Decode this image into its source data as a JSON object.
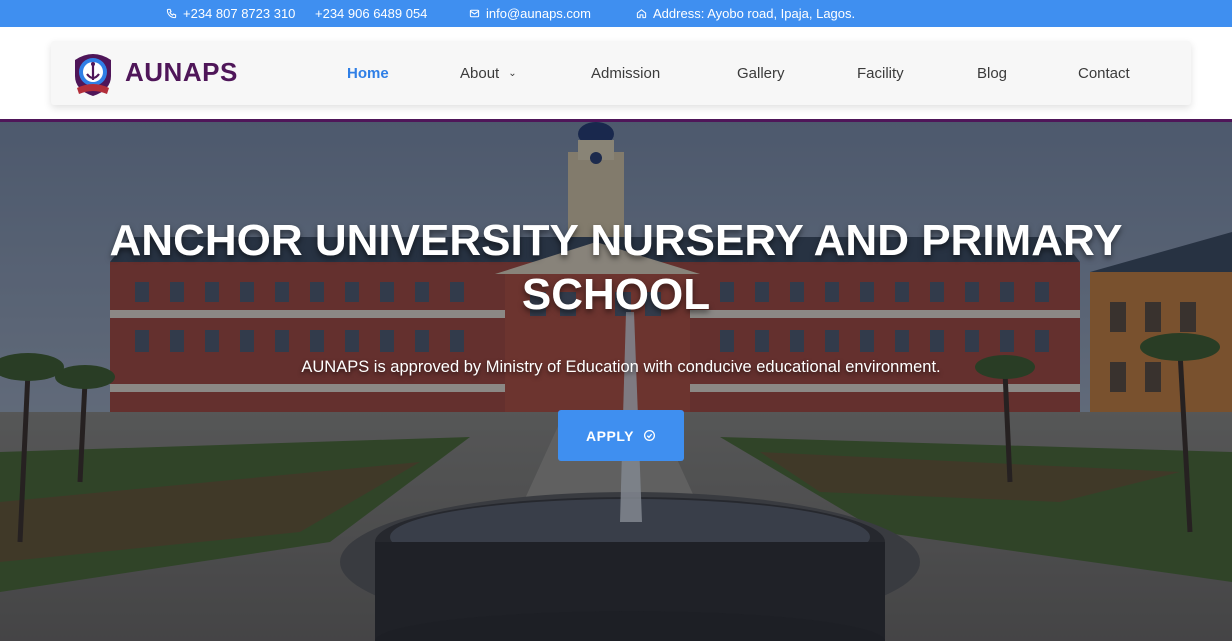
{
  "topbar": {
    "phone_1": "+234 807 8723 310",
    "phone_2": "+234 906 6489 054",
    "email": "info@aunaps.com",
    "address": "Address: Ayobo road, Ipaja, Lagos."
  },
  "brand": {
    "name": "AUNAPS",
    "color": "#4f1659"
  },
  "nav": {
    "items": [
      {
        "label": "Home",
        "active": true
      },
      {
        "label": "About",
        "has_dropdown": true
      },
      {
        "label": "Admission"
      },
      {
        "label": "Gallery"
      },
      {
        "label": "Facility"
      },
      {
        "label": "Blog"
      },
      {
        "label": "Contact"
      }
    ]
  },
  "hero": {
    "title_line_1": "ANCHOR UNIVERSITY NURSERY AND PRIMARY",
    "title_line_2": "SCHOOL",
    "subtitle": "AUNAPS is approved by Ministry of Education with conducive educational environment.",
    "cta_label": "APPLY",
    "cta_icon": "check-circle-icon"
  },
  "colors": {
    "accent": "#3f8ff0",
    "brand": "#4f1659",
    "nav_active": "#2f7fe6"
  }
}
